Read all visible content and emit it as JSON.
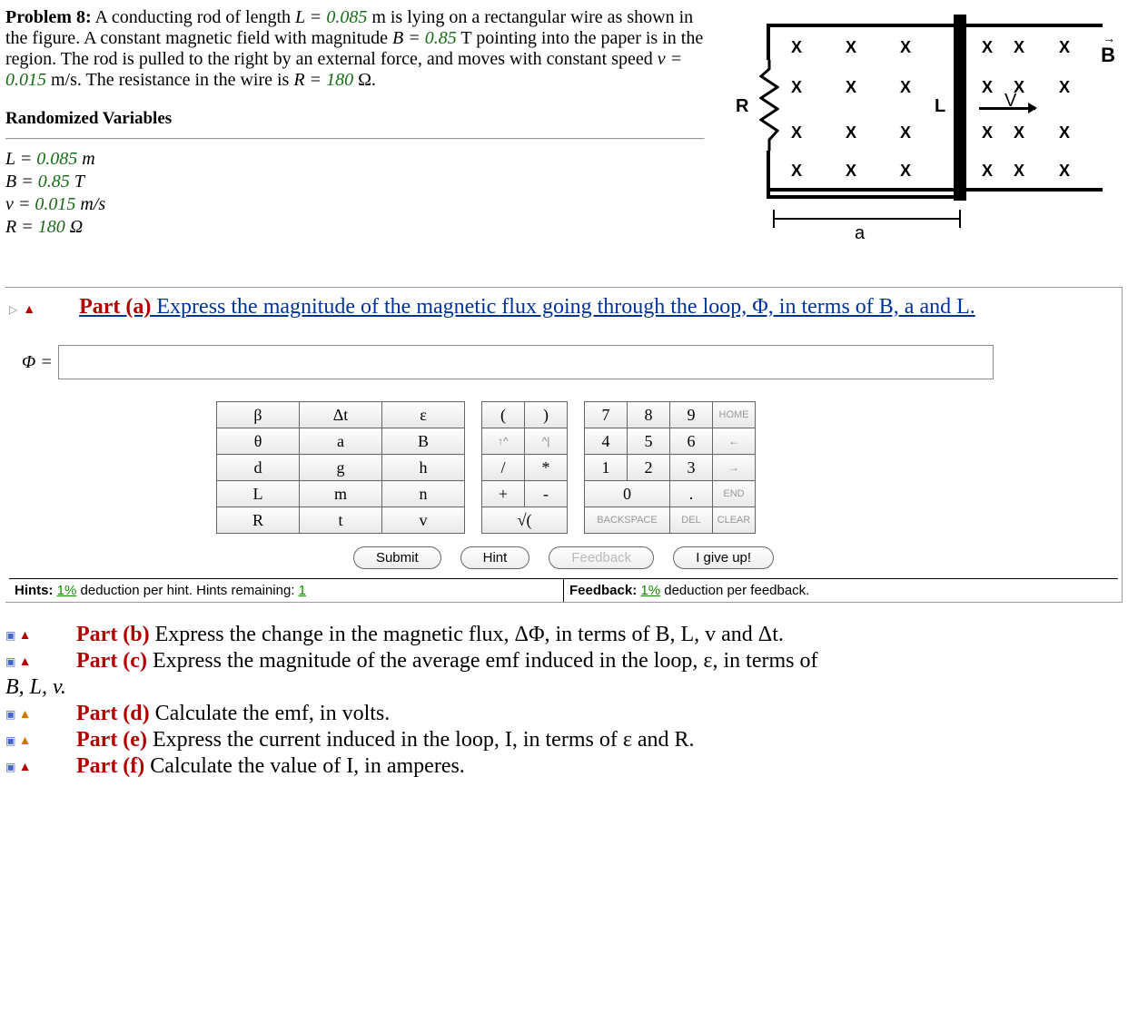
{
  "problem": {
    "label": "Problem 8:",
    "text_pre_L": "A conducting rod of length ",
    "L_sym": "L = ",
    "L_val": "0.085",
    "L_unit": " m is lying on a rectangular wire as shown in the figure. A constant magnetic field with magnitude ",
    "B_sym": "B = ",
    "B_val": "0.85",
    "B_unit": " T pointing into the paper is in the region. The rod is pulled to the right by an external force, and moves with constant speed ",
    "v_sym": "v = ",
    "v_val": "0.015",
    "v_unit": " m/s. The resistance in the wire is ",
    "R_sym": "R = ",
    "R_val": "180",
    "R_unit": " Ω."
  },
  "rv_header": "Randomized Variables",
  "vars": {
    "L": {
      "sym": "L = ",
      "val": "0.085",
      "unit": " m"
    },
    "B": {
      "sym": "B = ",
      "val": "0.85",
      "unit": " T"
    },
    "v": {
      "sym": "v = ",
      "val": "0.015",
      "unit": " m/s"
    },
    "R": {
      "sym": "R = ",
      "val": "180",
      "unit": " Ω"
    }
  },
  "figure": {
    "R": "R",
    "L": "L",
    "V": "V",
    "a": "a",
    "B": "B",
    "x": "X"
  },
  "part_a": {
    "label": "Part (a)",
    "text": "  Express the magnitude of the magnetic flux going through the loop, Φ, in terms of B, a and L."
  },
  "input": {
    "lhs": "Φ ="
  },
  "keypad": {
    "sym": [
      [
        "β",
        "Δt",
        "ε"
      ],
      [
        "θ",
        "a",
        "B"
      ],
      [
        "d",
        "g",
        "h"
      ],
      [
        "L",
        "m",
        "n"
      ],
      [
        "R",
        "t",
        "v"
      ]
    ],
    "ops": {
      "lp": "(",
      "rp": ")",
      "up": "↑^",
      "exp": "^|",
      "div": "/",
      "mul": "*",
      "plus": "+",
      "minus": "-",
      "sqrt": "√("
    },
    "num": {
      "r1": [
        "7",
        "8",
        "9"
      ],
      "home": "HOME",
      "r2": [
        "4",
        "5",
        "6"
      ],
      "left": "←",
      "r3": [
        "1",
        "2",
        "3"
      ],
      "right": "→",
      "zero": "0",
      "dot": ".",
      "end": "END",
      "back": "BACKSPACE",
      "del": "DEL",
      "clear": "CLEAR"
    }
  },
  "actions": {
    "submit": "Submit",
    "hint": "Hint",
    "feedback": "Feedback",
    "giveup": "I give up!"
  },
  "hints": {
    "left_pre": "Hints: ",
    "left_pct": "1%",
    "left_mid": " deduction per hint. Hints remaining: ",
    "left_rem": "1",
    "right_pre": "Feedback: ",
    "right_pct": "1%",
    "right_post": " deduction per feedback."
  },
  "parts": {
    "b": {
      "label": "Part (b)",
      "text": "  Express the change in the magnetic flux, ΔΦ, in terms of B, L, v and Δt."
    },
    "c": {
      "label": "Part (c)",
      "text1": "  Express the magnitude of the average emf induced in the loop, ε, in terms of",
      "text2": "B, L, v."
    },
    "d": {
      "label": "Part (d)",
      "text": "  Calculate the emf, in volts."
    },
    "e": {
      "label": "Part (e)",
      "text": "  Express the current induced in the loop, I, in terms of ε and R."
    },
    "f": {
      "label": "Part (f)",
      "text": "  Calculate the value of I, in amperes."
    }
  }
}
